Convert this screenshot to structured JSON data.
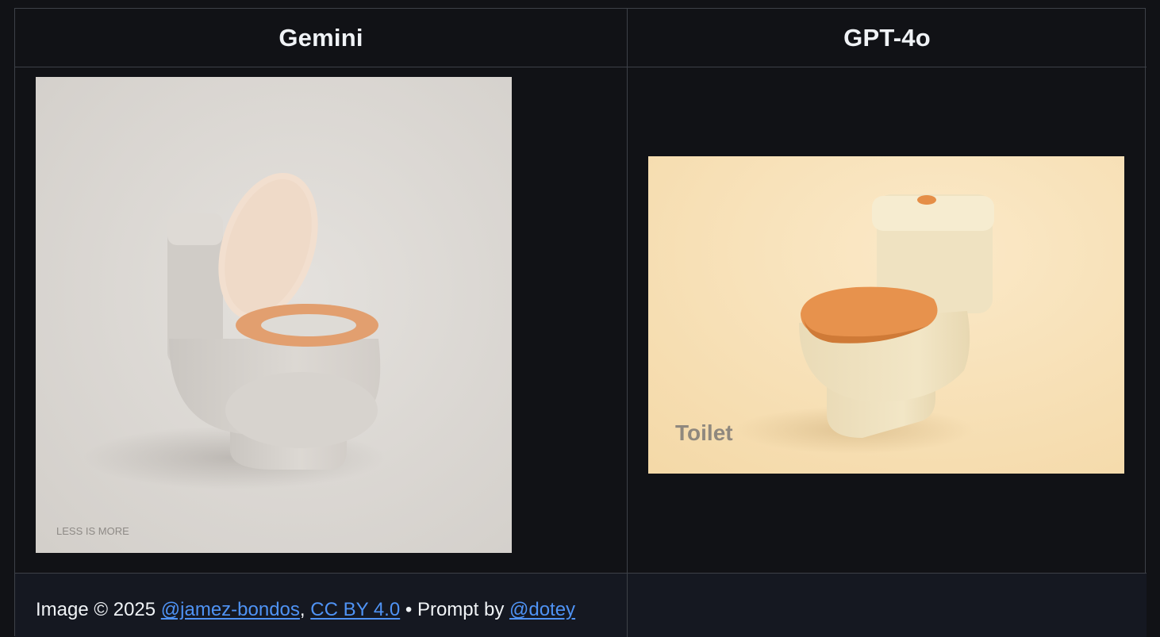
{
  "table": {
    "headers": [
      "Gemini",
      "GPT-4o"
    ]
  },
  "images": {
    "gemini": {
      "caption": "LESS IS MORE"
    },
    "gpt4o": {
      "caption": "Toilet"
    }
  },
  "footer": {
    "prefix": "Image © 2025 ",
    "author_link": "@jamez-bondos",
    "comma": ", ",
    "license_link": "CC BY 4.0",
    "separator": " • Prompt by ",
    "prompt_link": "@dotey"
  },
  "colors": {
    "background": "#111216",
    "border": "#3d4148",
    "link": "#4f93f5",
    "footer_bg": "#151821",
    "gemini_bg": "#dcd8d3",
    "gpt_bg": "#f9e4bc",
    "gemini_seat": "#e0a070",
    "gpt_seat": "#e8954e"
  }
}
